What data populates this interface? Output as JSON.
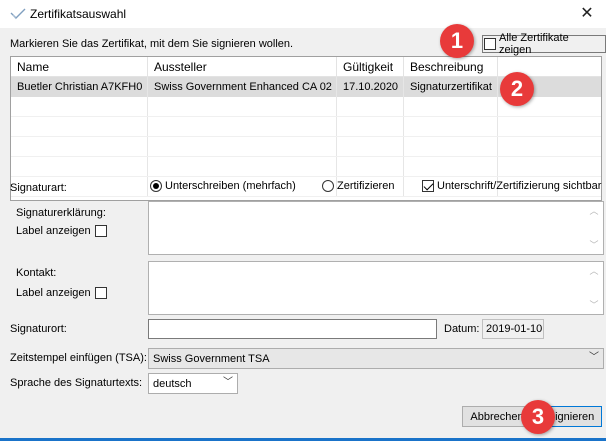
{
  "window": {
    "title": "Zertifikatsauswahl",
    "close_glyph": "✕"
  },
  "hint": "Markieren Sie das Zertifikat, mit dem Sie signieren wollen.",
  "show_all_label": "Alle Zertifikate zeigen",
  "table": {
    "headers": [
      "Name",
      "Aussteller",
      "Gültigkeit",
      "Beschreibung"
    ],
    "rows": [
      [
        "Buetler Christian A7KFH0",
        "Swiss Government Enhanced CA 02",
        "17.10.2020",
        "Signaturzertifikat"
      ]
    ]
  },
  "signature_type": {
    "label": "Signaturart:",
    "option_sign": "Unterschreiben (mehrfach)",
    "option_certify": "Zertifizieren",
    "visible_label": "Unterschrift/Zertifizierung sichtbar"
  },
  "declaration": {
    "label": "Signaturerklärung:",
    "show_label": "Label anzeigen"
  },
  "contact": {
    "label": "Kontakt:",
    "show_label": "Label anzeigen"
  },
  "location": {
    "label": "Signaturort:",
    "value": ""
  },
  "date": {
    "label": "Datum:",
    "value": "2019-01-10"
  },
  "tsa": {
    "label": "Zeitstempel einfügen (TSA):",
    "value": "Swiss Government TSA"
  },
  "language": {
    "label": "Sprache des Signaturtexts:",
    "value": "deutsch"
  },
  "buttons": {
    "cancel": "Abbrechen",
    "sign": "Signieren"
  },
  "badges": [
    "1",
    "2",
    "3"
  ],
  "colors": {
    "badge": "#e83a3a",
    "accent": "#0078d7",
    "selected_row": "#dcdcdc"
  }
}
